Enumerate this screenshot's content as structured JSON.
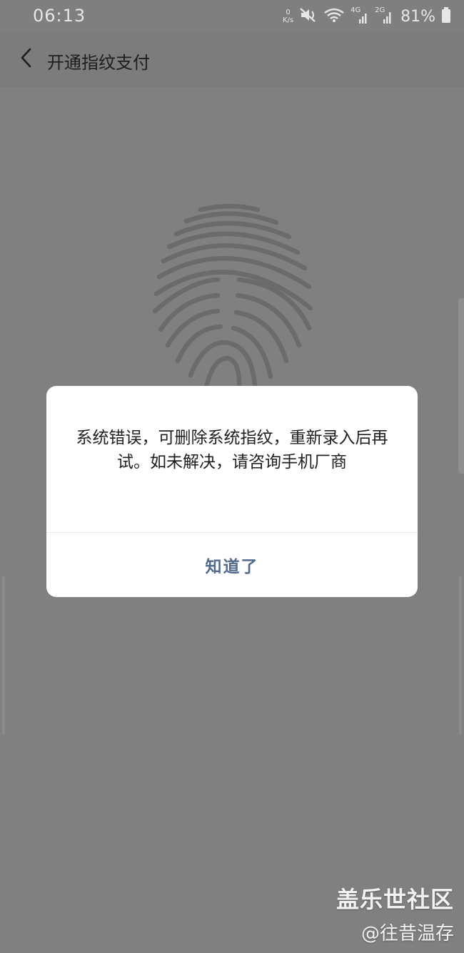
{
  "status_bar": {
    "time": "06:13",
    "net_speed_value": "0",
    "net_speed_unit": "K/s",
    "network_4g": "4G",
    "network_2g": "2G",
    "battery_percent": "81%"
  },
  "navbar": {
    "title": "开通指纹支付"
  },
  "dialog": {
    "message": "系统错误，可删除系统指纹，重新录入后再试。如未解决，请咨询手机厂商",
    "confirm_label": "知道了"
  },
  "watermark": {
    "brand": "盖乐世社区",
    "user": "@往昔温存"
  },
  "colors": {
    "overlay_background": "#808080",
    "dialog_background": "#ffffff",
    "button_text": "#546a8c",
    "fingerprint": "#6b6b6b"
  }
}
